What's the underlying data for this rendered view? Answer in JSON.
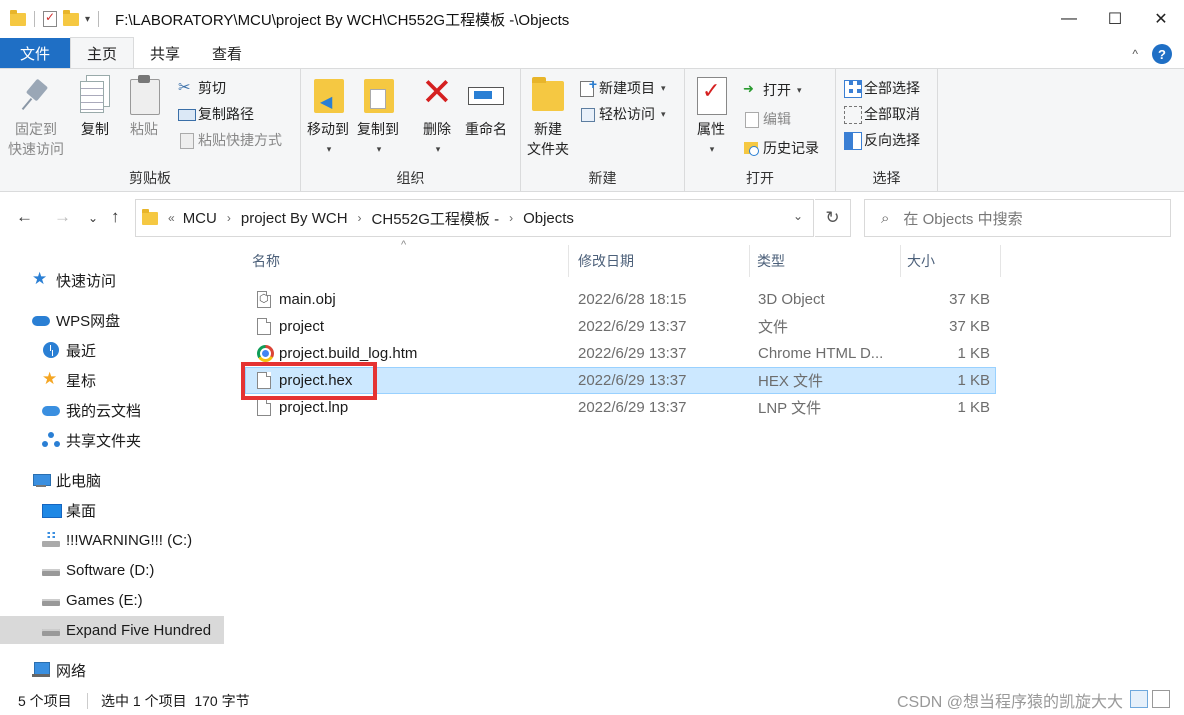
{
  "titlebar": {
    "path": "F:\\LABORATORY\\MCU\\project By WCH\\CH552G工程模板 -\\Objects",
    "minimize": "—",
    "maximize": "☐",
    "close": "✕"
  },
  "tabs": [
    "文件",
    "主页",
    "共享",
    "查看"
  ],
  "ribbon": {
    "clipboard": {
      "label": "剪贴板",
      "pin": [
        "固定到",
        "快速访问"
      ],
      "copy": "复制",
      "paste": "粘贴",
      "cut": "剪切",
      "copy_path": "复制路径",
      "paste_shortcut": "粘贴快捷方式"
    },
    "organize": {
      "label": "组织",
      "move_to": "移动到",
      "copy_to": "复制到",
      "delete": "删除",
      "rename": "重命名"
    },
    "new": {
      "label": "新建",
      "new_folder": [
        "新建",
        "文件夹"
      ],
      "new_item": "新建项目",
      "easy_access": "轻松访问"
    },
    "open": {
      "label": "打开",
      "properties": "属性",
      "open": "打开",
      "edit": "编辑",
      "history": "历史记录"
    },
    "select": {
      "label": "选择",
      "select_all": "全部选择",
      "select_none": "全部取消",
      "invert": "反向选择"
    }
  },
  "address": {
    "crumbs": [
      "MCU",
      "project By WCH",
      "CH552G工程模板 -",
      "Objects"
    ],
    "search_placeholder": "在 Objects 中搜索"
  },
  "sidebar": {
    "items": [
      {
        "label": "快速访问",
        "icon": "star-icon"
      },
      {
        "label": "WPS网盘",
        "icon": "cloud-icon"
      },
      {
        "label": "最近",
        "icon": "recent-icon"
      },
      {
        "label": "星标",
        "icon": "star-icon"
      },
      {
        "label": "我的云文档",
        "icon": "cloud-doc-icon"
      },
      {
        "label": "共享文件夹",
        "icon": "share-icon"
      },
      {
        "label": "此电脑",
        "icon": "computer-icon"
      },
      {
        "label": "桌面",
        "icon": "desktop-icon"
      },
      {
        "label": "!!!WARNING!!! (C:)",
        "icon": "windows-drive-icon"
      },
      {
        "label": "Software (D:)",
        "icon": "drive-icon"
      },
      {
        "label": "Games (E:)",
        "icon": "drive-icon"
      },
      {
        "label": "Expand Five Hundred",
        "icon": "drive-icon"
      },
      {
        "label": "网络",
        "icon": "network-icon"
      }
    ]
  },
  "columns": [
    "名称",
    "修改日期",
    "类型",
    "大小"
  ],
  "files": [
    {
      "name": "main.obj",
      "date": "2022/6/28 18:15",
      "type": "3D Object",
      "size": "37 KB"
    },
    {
      "name": "project",
      "date": "2022/6/29 13:37",
      "type": "文件",
      "size": "37 KB"
    },
    {
      "name": "project.build_log.htm",
      "date": "2022/6/29 13:37",
      "type": "Chrome HTML D...",
      "size": "1 KB"
    },
    {
      "name": "project.hex",
      "date": "2022/6/29 13:37",
      "type": "HEX 文件",
      "size": "1 KB"
    },
    {
      "name": "project.lnp",
      "date": "2022/6/29 13:37",
      "type": "LNP 文件",
      "size": "1 KB"
    }
  ],
  "status": {
    "count": "5 个项目",
    "selected": "选中 1 个项目  170 字节"
  },
  "watermark": "CSDN @想当程序猿的凯旋大大",
  "colors": {
    "accent": "#1f6fc5",
    "selection": "#cce8ff",
    "highlight_box": "#e53333"
  }
}
